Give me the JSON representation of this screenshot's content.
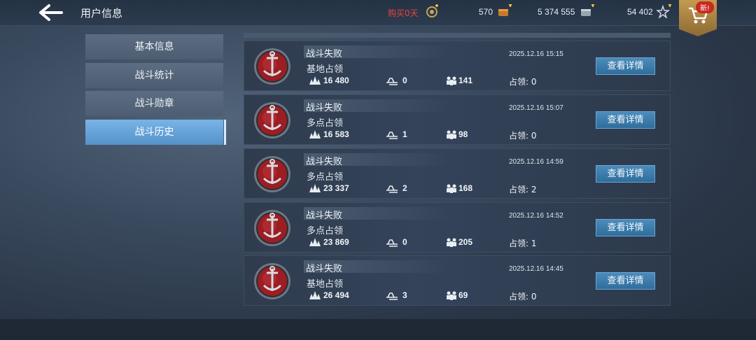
{
  "header": {
    "title": "用户信息",
    "buy_text": "购买0天",
    "resources": [
      "570",
      "5 374 555",
      "54 402"
    ],
    "new_badge": "新!"
  },
  "sidebar": {
    "tabs": [
      {
        "label": "基本信息",
        "active": false
      },
      {
        "label": "战斗统计",
        "active": false
      },
      {
        "label": "战斗勋章",
        "active": false
      },
      {
        "label": "战斗历史",
        "active": true
      }
    ]
  },
  "battles": [
    {
      "result": "战斗失败",
      "mode": "基地占领",
      "time": "2025.12.16 15:15",
      "damage": "16 480",
      "kills": "0",
      "xp": "141",
      "capture": "占领: 0",
      "button": "查看详情"
    },
    {
      "result": "战斗失败",
      "mode": "多点占领",
      "time": "2025.12.16 15:07",
      "damage": "16 583",
      "kills": "1",
      "xp": "98",
      "capture": "占领: 0",
      "button": "查看详情"
    },
    {
      "result": "战斗失败",
      "mode": "多点占领",
      "time": "2025.12.16 14:59",
      "damage": "23 337",
      "kills": "2",
      "xp": "168",
      "capture": "占领: 2",
      "button": "查看详情"
    },
    {
      "result": "战斗失败",
      "mode": "多点占领",
      "time": "2025.12.16 14:52",
      "damage": "23 869",
      "kills": "0",
      "xp": "205",
      "capture": "占领: 1",
      "button": "查看详情"
    },
    {
      "result": "战斗失败",
      "mode": "基地占领",
      "time": "2025.12.16 14:45",
      "damage": "26 494",
      "kills": "3",
      "xp": "69",
      "capture": "占领: 0",
      "button": "查看详情"
    }
  ],
  "colors": {
    "accent": "#5592c9",
    "buy_red": "#e6463a",
    "button": "#2f6d9c",
    "gold": "#c39a50"
  },
  "icons": [
    "back-arrow-icon",
    "premium-medal-icon",
    "gold-icon",
    "silver-icon",
    "star-icon",
    "shop-cart-icon",
    "defeat-emblem-icon",
    "damage-icon",
    "ship-kill-icon",
    "xp-icon"
  ]
}
